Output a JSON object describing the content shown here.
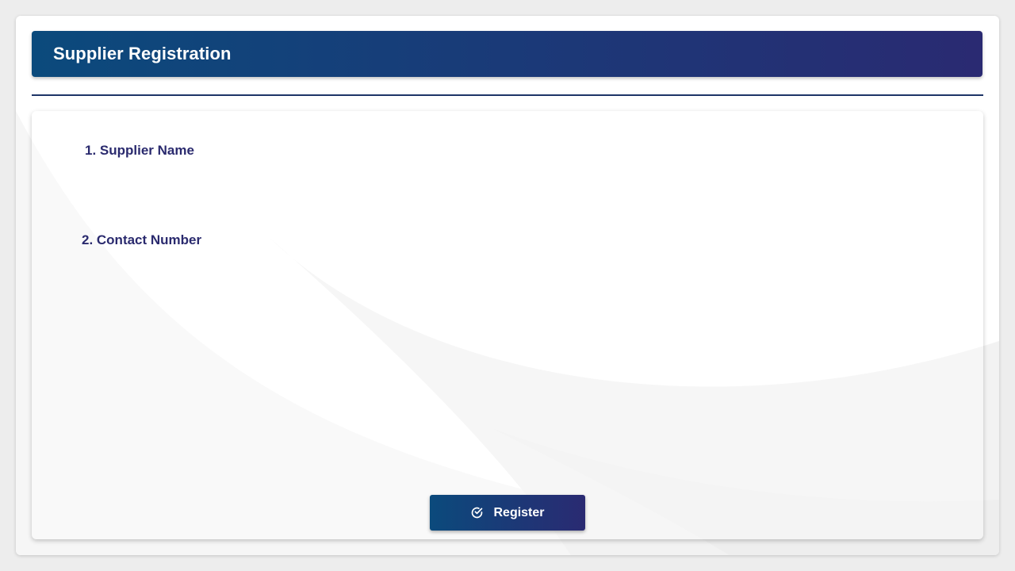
{
  "header": {
    "title": "Supplier Registration"
  },
  "form": {
    "fields": [
      {
        "label": "1. Supplier Name"
      },
      {
        "label": "2. Contact Number"
      }
    ],
    "submit": {
      "label": "Register",
      "icon": "check-circle-icon"
    }
  },
  "colors": {
    "header_gradient_start": "#0b4a7c",
    "header_gradient_end": "#2a2a72",
    "label_color": "#2a2a6e",
    "divider": "#1d3567"
  }
}
